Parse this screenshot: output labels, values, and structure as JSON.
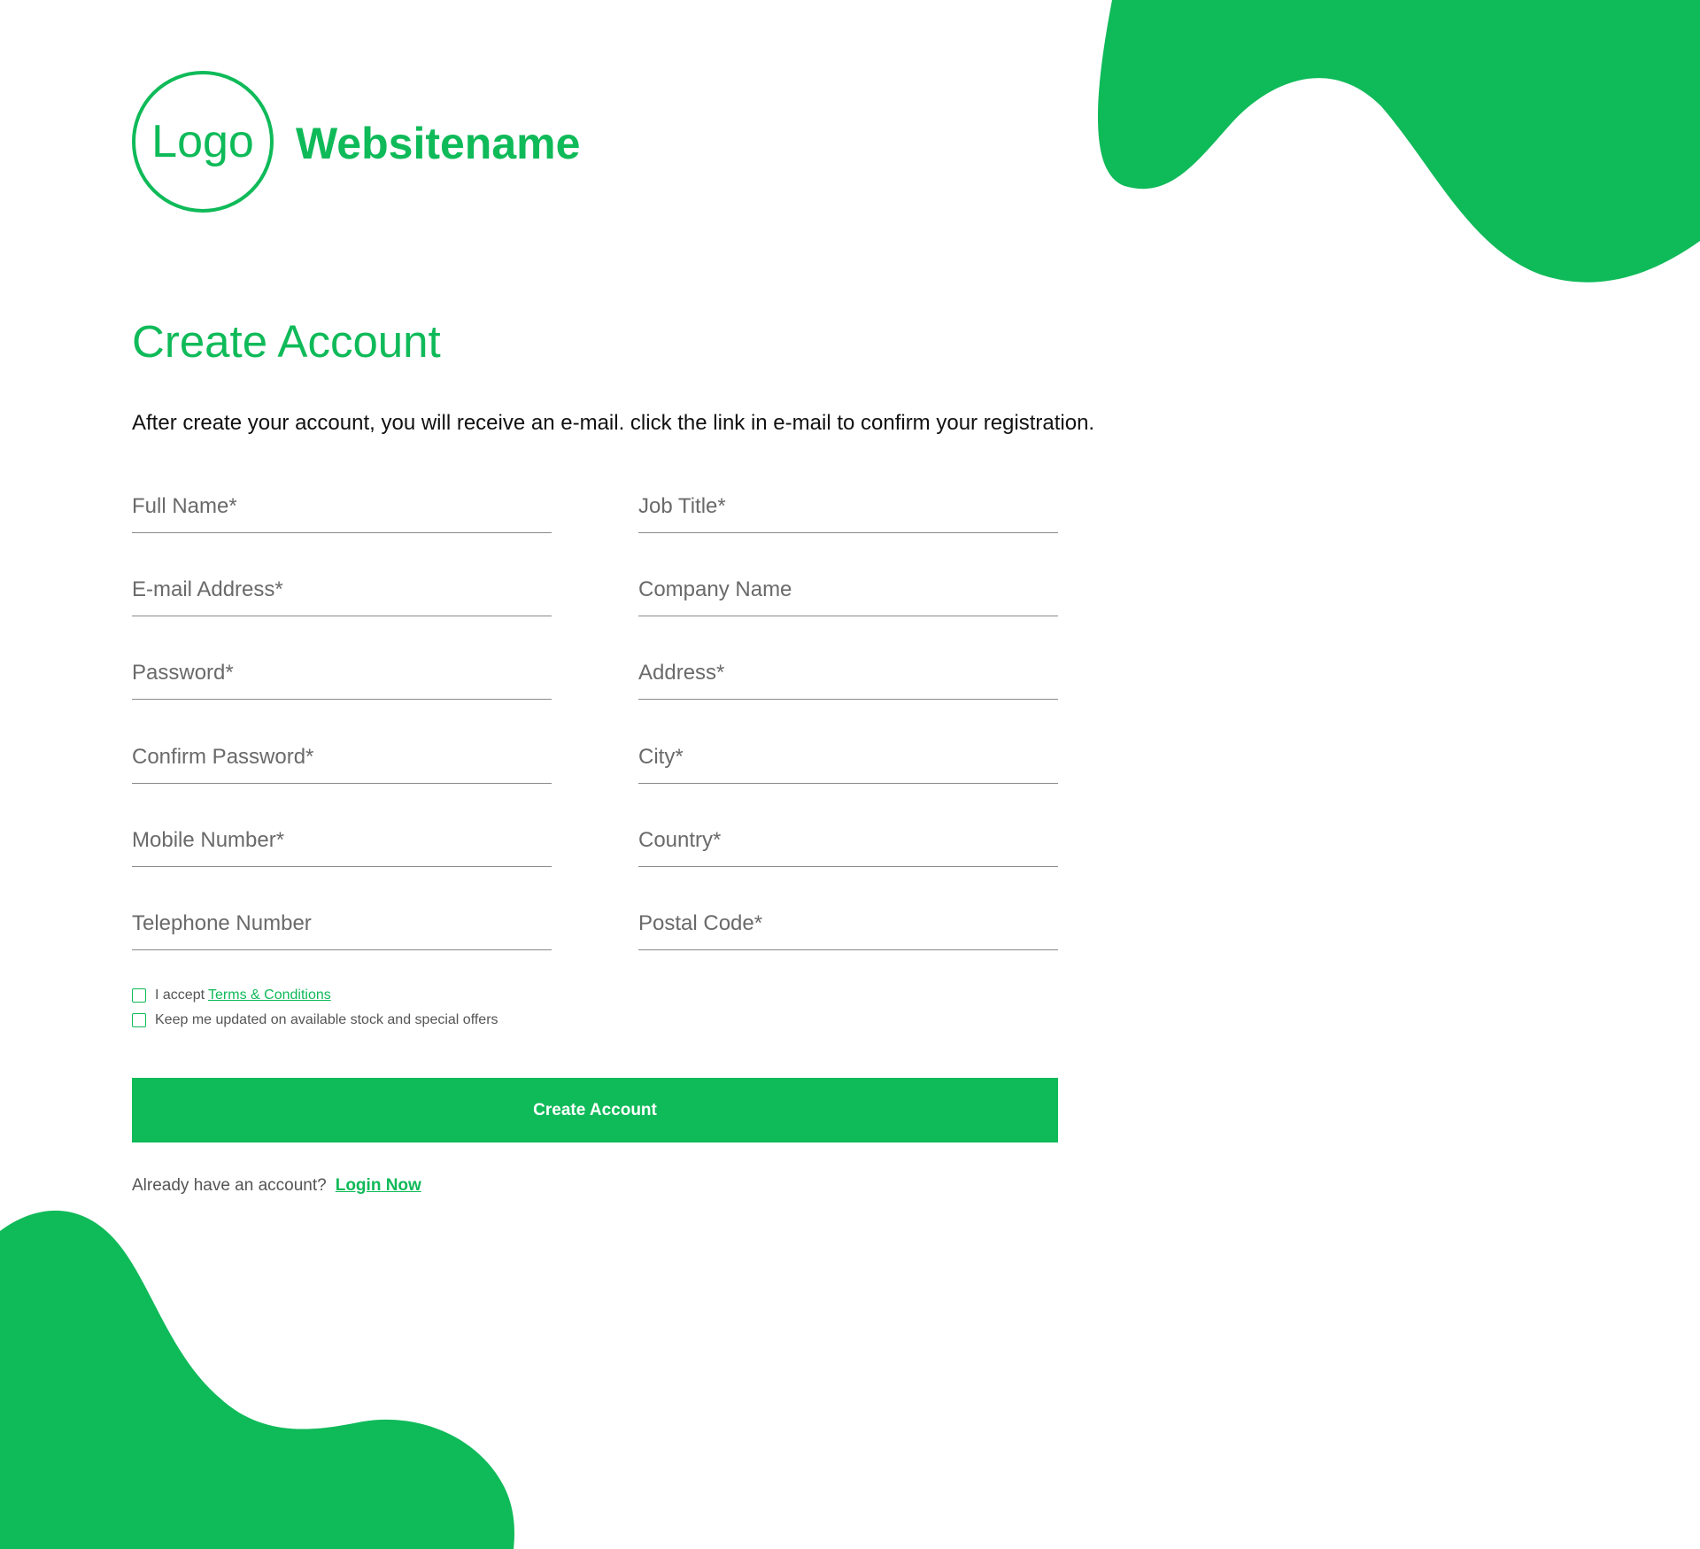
{
  "brand": {
    "logo_text": "Logo",
    "site_name": "Websitename",
    "accent_color": "#0fba59"
  },
  "page": {
    "title": "Create Account",
    "intro": "After create your account, you will receive an e-mail. click the link in e-mail to confirm your registration."
  },
  "form": {
    "left_fields": [
      {
        "placeholder": "Full Name*",
        "value": ""
      },
      {
        "placeholder": "E-mail Address*",
        "value": ""
      },
      {
        "placeholder": "Password*",
        "value": ""
      },
      {
        "placeholder": "Confirm Password*",
        "value": ""
      },
      {
        "placeholder": "Mobile Number*",
        "value": ""
      },
      {
        "placeholder": "Telephone Number",
        "value": ""
      }
    ],
    "right_fields": [
      {
        "placeholder": "Job Title*",
        "value": ""
      },
      {
        "placeholder": "Company Name",
        "value": ""
      },
      {
        "placeholder": "Address*",
        "value": ""
      },
      {
        "placeholder": "City*",
        "value": ""
      },
      {
        "placeholder": "Country*",
        "value": ""
      },
      {
        "placeholder": "Postal Code*",
        "value": ""
      }
    ],
    "terms": {
      "prefix": "I accept",
      "link": "Terms & Conditions",
      "checked": false
    },
    "newsletter": {
      "label": "Keep me updated on available stock and special offers",
      "checked": false
    },
    "submit_label": "Create Account"
  },
  "login": {
    "prompt": "Already have an account?",
    "link": "Login Now"
  }
}
